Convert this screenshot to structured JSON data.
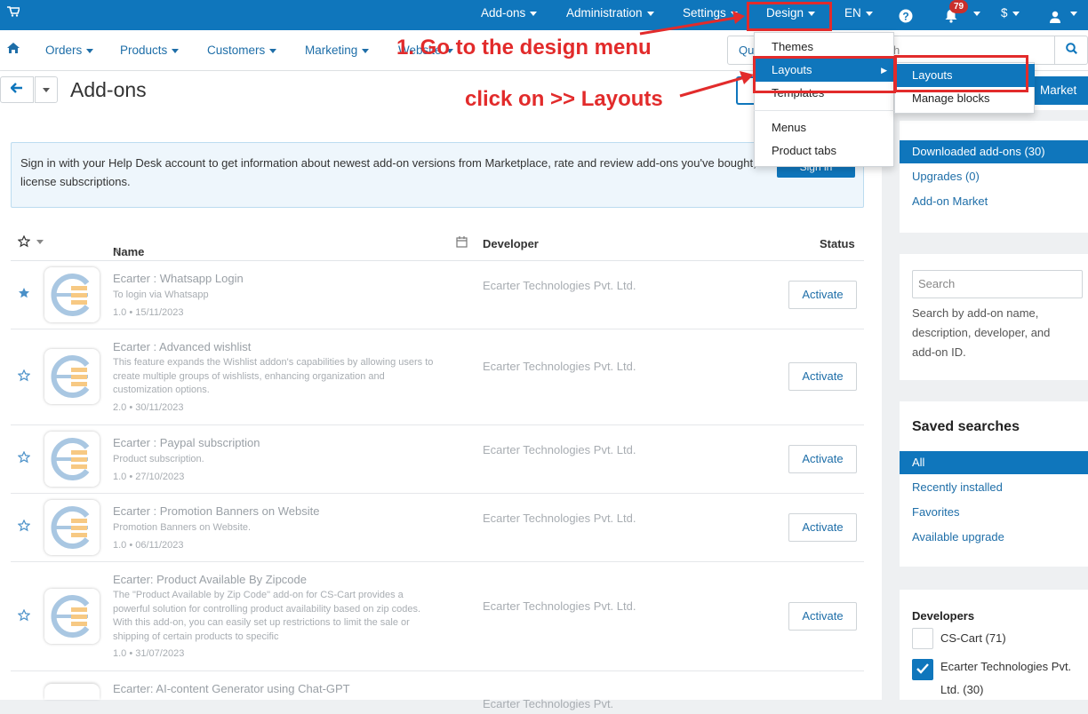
{
  "topbar": {
    "items": [
      "Add-ons",
      "Administration",
      "Settings",
      "Design",
      "EN",
      "$"
    ],
    "notification_count": "79"
  },
  "secnav": {
    "items": [
      "Orders",
      "Products",
      "Customers",
      "Marketing",
      "Website"
    ],
    "search_prefix": "Qu",
    "search_suffix": "h"
  },
  "page": {
    "title": "Add-ons",
    "market_button": "Market",
    "info_text": "Sign in with your Help Desk account to get information about newest add-on versions from Marketplace, rate and review add-ons you've bought, and prolong your license subscriptions.",
    "signin_label": "Sign in"
  },
  "table": {
    "headers": {
      "name": "Name",
      "developer": "Developer",
      "status": "Status"
    },
    "rows": [
      {
        "name": "Ecarter : Whatsapp Login",
        "desc": "To login via Whatsapp",
        "meta": "1.0 • 15/11/2023",
        "developer": "Ecarter Technologies Pvt. Ltd.",
        "action": "Activate"
      },
      {
        "name": "Ecarter : Advanced wishlist",
        "desc": "This feature expands the Wishlist addon's capabilities by allowing users to create multiple groups of wishlists, enhancing organization and customization options.",
        "meta": "2.0 • 30/11/2023",
        "developer": "Ecarter Technologies Pvt. Ltd.",
        "action": "Activate"
      },
      {
        "name": "Ecarter : Paypal subscription",
        "desc": "Product subscription.",
        "meta": "1.0 • 27/10/2023",
        "developer": "Ecarter Technologies Pvt. Ltd.",
        "action": "Activate"
      },
      {
        "name": "Ecarter : Promotion Banners on Website",
        "desc": "Promotion Banners on Website.",
        "meta": "1.0 • 06/11/2023",
        "developer": "Ecarter Technologies Pvt. Ltd.",
        "action": "Activate"
      },
      {
        "name": "Ecarter: Product Available By Zipcode",
        "desc": "The \"Product Available by Zip Code\" add-on for CS-Cart provides a powerful solution for controlling product availability based on zip codes. With this add-on, you can easily set up restrictions to limit the sale or shipping of certain products to specific",
        "meta": "1.0 • 31/07/2023",
        "developer": "Ecarter Technologies Pvt. Ltd.",
        "action": "Activate"
      },
      {
        "name": "Ecarter: AI-content Generator using Chat-GPT",
        "desc": "",
        "meta": "",
        "developer": "Ecarter Technologies Pvt.",
        "action": ""
      }
    ]
  },
  "sidebar": {
    "filters": [
      "Downloaded add-ons (30)",
      "Upgrades (0)",
      "Add-on Market"
    ],
    "search_placeholder": "Search",
    "search_help": "Search by add-on name, description, developer, and add-on ID.",
    "saved_title": "Saved searches",
    "saved": [
      "All",
      "Recently installed",
      "Favorites",
      "Available upgrade"
    ],
    "developers_title": "Developers",
    "developers": [
      "CS-Cart (71)",
      "Ecarter Technologies Pvt. Ltd. (30)"
    ]
  },
  "design_menu": {
    "items": [
      "Themes",
      "Layouts",
      "Templates",
      "Menus",
      "Product tabs"
    ],
    "submenu": [
      "Layouts",
      "Manage blocks"
    ]
  },
  "annotations": {
    "step1": "1. Go to the design menu",
    "step2": "click on >> Layouts"
  },
  "colors": {
    "primary": "#0f76bc",
    "annotation": "#e22b2b"
  }
}
